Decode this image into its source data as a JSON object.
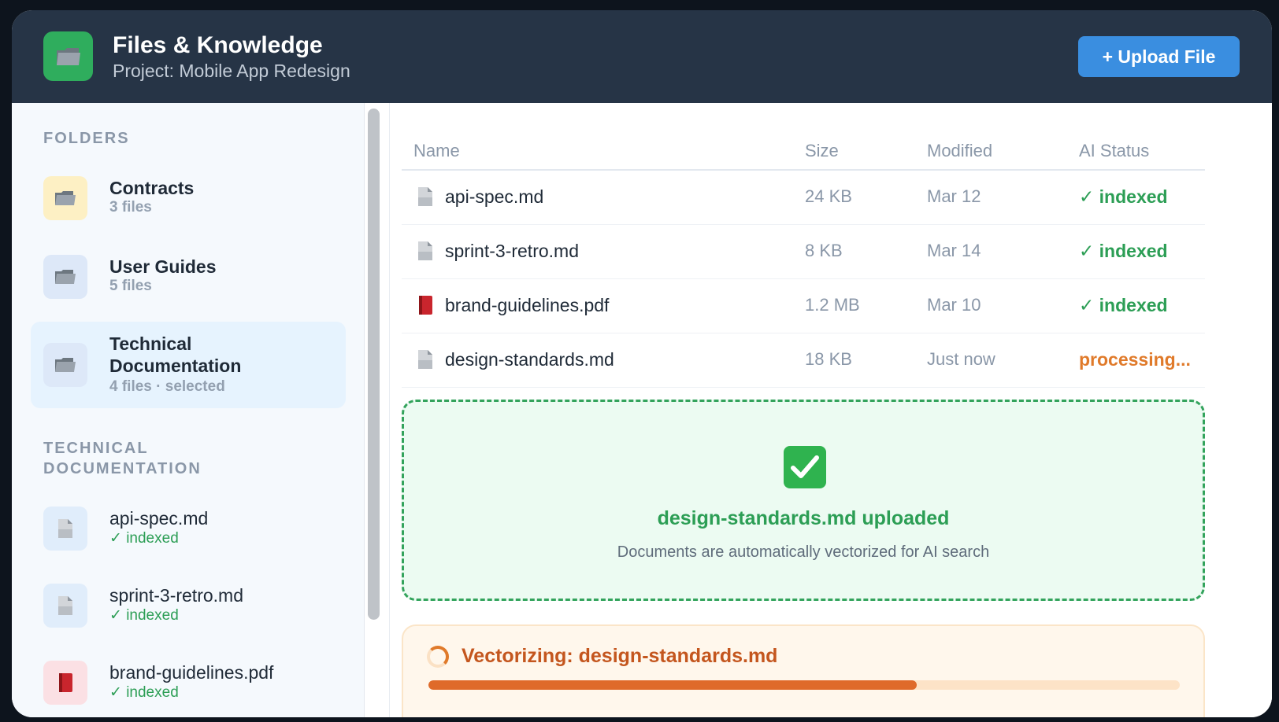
{
  "header": {
    "title": "Files & Knowledge",
    "subtitle": "Project: Mobile App Redesign",
    "upload_label": "+ Upload File",
    "app_icon": "folder-icon"
  },
  "sidebar": {
    "folders_label": "FOLDERS",
    "folders": [
      {
        "name": "Contracts",
        "meta": "3 files",
        "icon": "folder-icon"
      },
      {
        "name": "User Guides",
        "meta": "5 files",
        "icon": "folder-icon"
      },
      {
        "name": "Technical Documentation",
        "meta": "4 files · selected",
        "icon": "folder-icon",
        "selected": true
      }
    ],
    "section_label": "TECHNICAL DOCUMENTATION",
    "files": [
      {
        "name": "api-spec.md",
        "status": "✓ indexed",
        "icon": "document-icon"
      },
      {
        "name": "sprint-3-retro.md",
        "status": "✓ indexed",
        "icon": "document-icon"
      },
      {
        "name": "brand-guidelines.pdf",
        "status": "✓ indexed",
        "icon": "book-icon"
      }
    ]
  },
  "table": {
    "columns": [
      "Name",
      "Size",
      "Modified",
      "AI Status"
    ],
    "rows": [
      {
        "name": "api-spec.md",
        "size": "24 KB",
        "modified": "Mar 12",
        "status": "✓ indexed",
        "icon": "document-icon"
      },
      {
        "name": "sprint-3-retro.md",
        "size": "8 KB",
        "modified": "Mar 14",
        "status": "✓ indexed",
        "icon": "document-icon"
      },
      {
        "name": "brand-guidelines.pdf",
        "size": "1.2 MB",
        "modified": "Mar 10",
        "status": "✓ indexed",
        "icon": "book-icon"
      },
      {
        "name": "design-standards.md",
        "size": "18 KB",
        "modified": "Just now",
        "status": "processing...",
        "icon": "document-icon"
      }
    ]
  },
  "upload": {
    "icon": "check-mark-icon",
    "title": "design-standards.md uploaded",
    "description": "Documents are automatically vectorized for AI search"
  },
  "progress": {
    "title": "Vectorizing: design-standards.md",
    "value": 0.65
  },
  "colors": {
    "header_bg": "#263446",
    "accent": "#3a8ee0",
    "success": "#2c9e55",
    "warning": "#e07a2a",
    "progress_fill": "#df6a2a"
  }
}
